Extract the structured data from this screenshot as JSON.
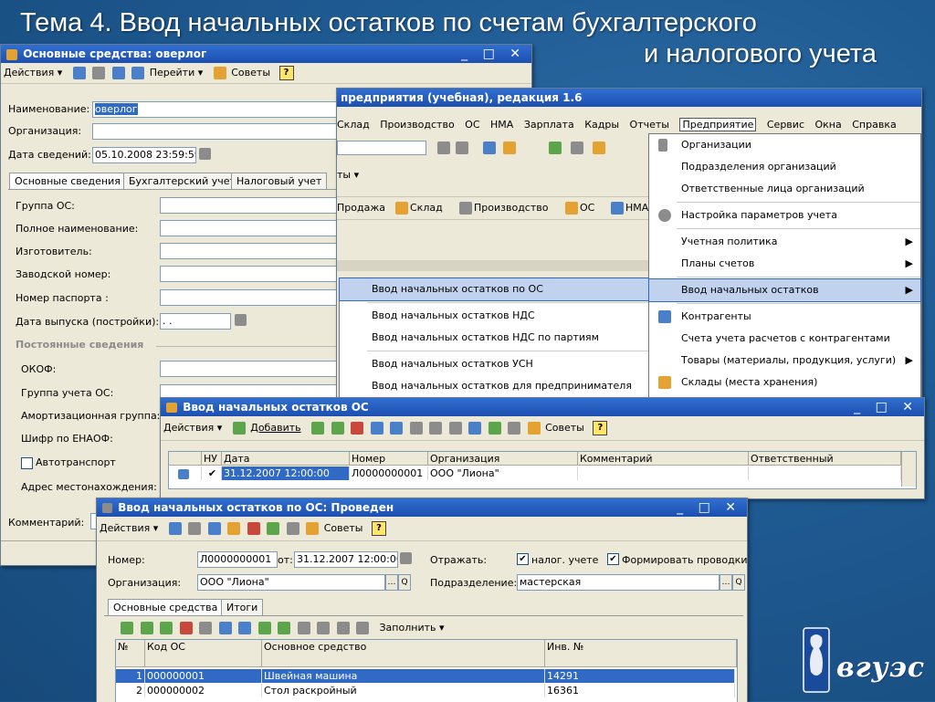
{
  "slide": {
    "title_line1": "Тема 4. Ввод начальных остатков по счетам бухгалтерского",
    "title_line2": "и налогового учета"
  },
  "colors": {
    "titlebar": "#1d4fb0",
    "selection": "#316ac5",
    "background": "#1f5b93"
  },
  "win_os": {
    "title": "Основные средства: оверлог",
    "controls": "_ □ ✕",
    "toolbar": {
      "actions": "Действия ▾",
      "goto": "Перейти ▾",
      "tips": "Советы",
      "help": "?"
    },
    "fields": {
      "name_label": "Наименование:",
      "name_value": "оверлог",
      "org_label": "Организация:",
      "org_value": "",
      "date_label": "Дата сведений:",
      "date_value": "05.10.2008 23:59:59"
    },
    "tabs": [
      "Основные сведения",
      "Бухгалтерский учет",
      "Налоговый учет"
    ],
    "rows": [
      "Группа ОС:",
      "Полное наименование:",
      "Изготовитель:",
      "Заводской номер:",
      "Номер паспорта :",
      "Дата выпуска (постройки):"
    ],
    "release_date_value": ". .",
    "section_label": "Постоянные сведения",
    "rows2": [
      "ОКОФ:",
      "Группа учета ОС:",
      "Амортизационная группа:",
      "Шифр по ЕНАОФ:"
    ],
    "auto_label": "Автотранспорт",
    "address_label": "Адрес местонахождения:",
    "comment_label": "Комментарий:"
  },
  "win_main": {
    "title": "предприятия (учебная), редакция 1.6",
    "menu": [
      "Склад",
      "Производство",
      "ОС",
      "НМА",
      "Зарплата",
      "Кадры",
      "Отчеты",
      "Предприятие",
      "Сервис",
      "Окна",
      "Справка"
    ],
    "toolbar2": [
      "Продажа",
      "Склад",
      "Производство",
      "ОС",
      "НМА"
    ],
    "ty_label": "ты ▾",
    "submenu": [
      "Ввод начальных остатков по ОС",
      "Ввод начальных остатков НДС",
      "Ввод начальных остатков НДС по партиям",
      "Ввод начальных остатков УСН",
      "Ввод начальных остатков для предпринимателя"
    ],
    "dropdown": [
      {
        "label": "Организации",
        "icon": "document-icon",
        "arrow": ""
      },
      {
        "label": "Подразделения организаций",
        "icon": "",
        "arrow": ""
      },
      {
        "label": "Ответственные лица организаций",
        "icon": "",
        "arrow": ""
      },
      {
        "label": "Настройка параметров учета",
        "icon": "gear-icon",
        "arrow": ""
      },
      {
        "label": "Учетная политика",
        "icon": "",
        "arrow": "▶"
      },
      {
        "label": "Планы счетов",
        "icon": "",
        "arrow": "▶"
      },
      {
        "label": "Ввод начальных остатков",
        "icon": "",
        "arrow": "▶"
      },
      {
        "label": "Контрагенты",
        "icon": "people-icon",
        "arrow": ""
      },
      {
        "label": "Счета учета расчетов с контрагентами",
        "icon": "",
        "arrow": ""
      },
      {
        "label": "Товары (материалы, продукция, услуги)",
        "icon": "",
        "arrow": "▶"
      },
      {
        "label": "Склады (места хранения)",
        "icon": "warehouse-icon",
        "arrow": ""
      }
    ]
  },
  "win_list": {
    "title": "Ввод начальных остатков ОС",
    "controls": "_ □ ✕",
    "toolbar": {
      "actions": "Действия ▾",
      "add": "Добавить",
      "tips": "Советы",
      "help": "?"
    },
    "headers": [
      "НУ",
      "Дата",
      "Номер",
      "Организация",
      "Комментарий",
      "Ответственный"
    ],
    "row": {
      "nu": "✔",
      "date": "31.12.2007 12:00:00",
      "number": "Л0000000001",
      "org": "ООО \"Лиона\"",
      "comment": "",
      "resp": ""
    }
  },
  "win_doc": {
    "title": "Ввод начальных остатков по ОС: Проведен",
    "controls": "_ □ ✕",
    "toolbar": {
      "actions": "Действия ▾",
      "tips": "Советы",
      "help": "?"
    },
    "number_label": "Номер:",
    "number_value": "Л0000000001",
    "from_label": "от:",
    "from_value": "31.12.2007 12:00:00",
    "reflect_label": "Отражать:",
    "tax_check": "налог. учете",
    "post_check": "Формировать проводки",
    "org_label": "Организация:",
    "org_value": "ООО \"Лиона\"",
    "dept_label": "Подразделение:",
    "dept_value": "мастерская",
    "tabs": [
      "Основные средства",
      "Итоги"
    ],
    "fill_label": "Заполнить ▾",
    "headers": [
      "№",
      "Код ОС",
      "Основное средство",
      "Инв. №"
    ],
    "rows": [
      {
        "n": "1",
        "code": "000000001",
        "name": "Швейная машина",
        "inv": "14291"
      },
      {
        "n": "2",
        "code": "000000002",
        "name": "Стол раскройный",
        "inv": "16361"
      }
    ]
  },
  "logo": {
    "text": "вгуэс"
  }
}
